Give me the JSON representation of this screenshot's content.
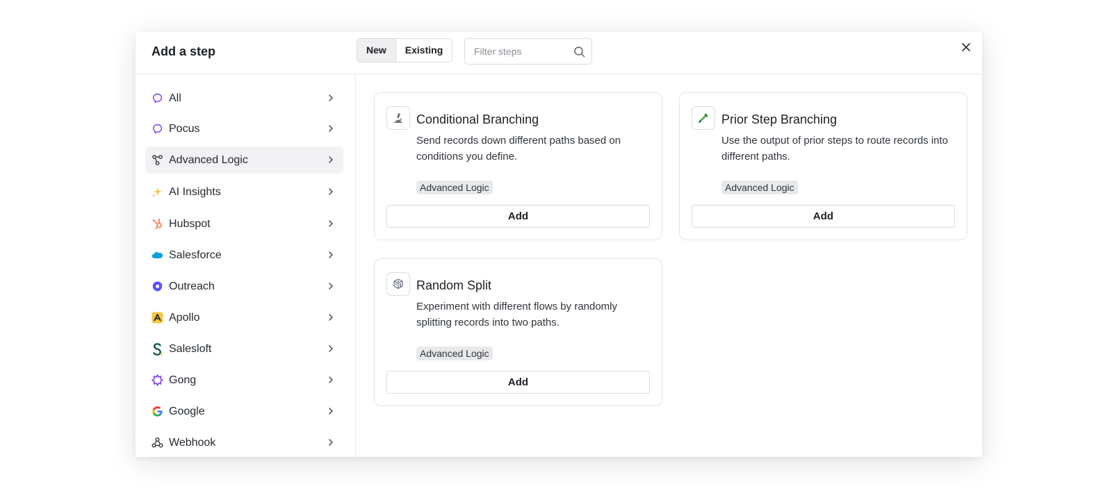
{
  "dialog": {
    "title": "Add a step",
    "toggle": {
      "new_label": "New",
      "existing_label": "Existing",
      "active": "New"
    },
    "filter_placeholder": "Filter steps"
  },
  "sidebar": {
    "items": [
      {
        "label": "All",
        "icon": "brain-outline-icon"
      },
      {
        "label": "Pocus",
        "icon": "brain-outline-icon"
      },
      {
        "label": "Advanced Logic",
        "icon": "branch-nodes-icon",
        "selected": true
      },
      {
        "label": "AI Insights",
        "icon": "sparkles-icon"
      },
      {
        "label": "Hubspot",
        "icon": "hubspot-logo-icon"
      },
      {
        "label": "Salesforce",
        "icon": "salesforce-cloud-icon"
      },
      {
        "label": "Outreach",
        "icon": "outreach-logo-icon"
      },
      {
        "label": "Apollo",
        "icon": "apollo-logo-icon"
      },
      {
        "label": "Salesloft",
        "icon": "salesloft-logo-icon"
      },
      {
        "label": "Gong",
        "icon": "gong-logo-icon"
      },
      {
        "label": "Google",
        "icon": "google-logo-icon"
      },
      {
        "label": "Webhook",
        "icon": "webhook-icon"
      }
    ]
  },
  "cards": [
    {
      "title": "Conditional Branching",
      "description": "Send records down different paths based on conditions you define.",
      "tag": "Advanced Logic",
      "add_label": "Add",
      "icon": "microscope-icon"
    },
    {
      "title": "Prior Step Branching",
      "description": "Use the output of prior steps to route records into different paths.",
      "tag": "Advanced Logic",
      "add_label": "Add",
      "icon": "pen-icon"
    },
    {
      "title": "Random Split",
      "description": "Experiment with different flows by randomly splitting records into two paths.",
      "tag": "Advanced Logic",
      "add_label": "Add",
      "icon": "dice-icon"
    }
  ],
  "colors": {
    "selected_bg": "#f2f2f4",
    "brand_purple": "#7b3fe4",
    "hubspot": "#ff7a59",
    "salesforce": "#00a1e0",
    "outreach": "#5951ff",
    "apollo": "#f5c542",
    "salesloft": "#0c5e3a"
  }
}
